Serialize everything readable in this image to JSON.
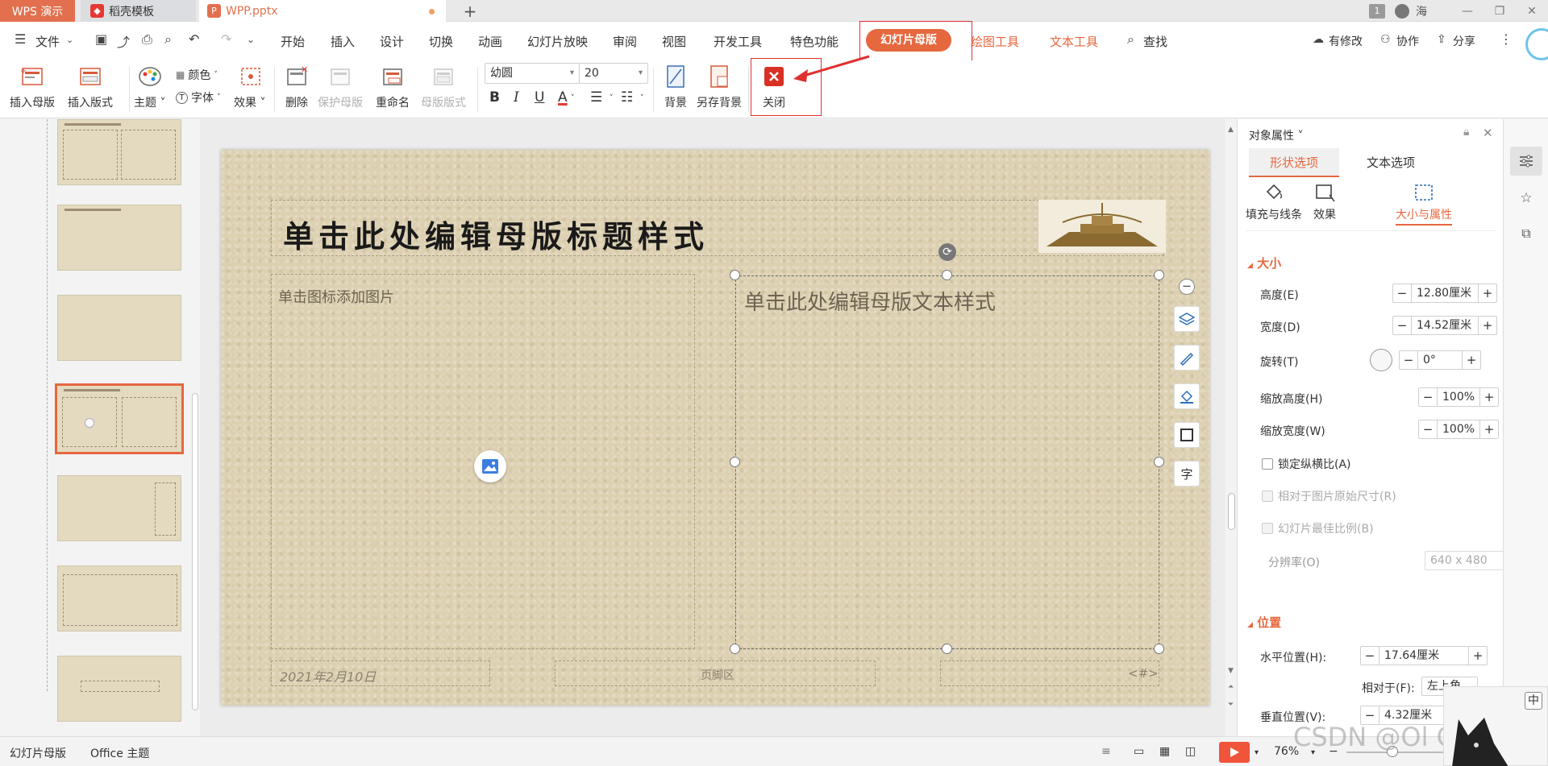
{
  "tabs": {
    "wps": "WPS 演示",
    "daoke": "稻壳模板",
    "wpp": "WPP.pptx",
    "add": "+"
  },
  "window": {
    "badge": "1",
    "user": "海",
    "minimize": "—",
    "restore": "❐",
    "close": "✕"
  },
  "menu": {
    "file": "文件",
    "items": [
      "开始",
      "插入",
      "设计",
      "切换",
      "动画",
      "幻灯片放映",
      "审阅",
      "视图",
      "开发工具",
      "特色功能"
    ],
    "slide_master": "幻灯片母版",
    "draw_tools": "绘图工具",
    "text_tools": "文本工具",
    "search": "查找",
    "has_changes": "有修改",
    "collab": "协作",
    "share": "分享"
  },
  "ribbon": {
    "insert_master": "插入母版",
    "insert_layout": "插入版式",
    "theme": "主题",
    "colors": "颜色",
    "fonts": "字体",
    "effects": "效果",
    "delete": "删除",
    "protect_master": "保护母版",
    "rename": "重命名",
    "master_layout": "母版版式",
    "font_name": "幼圆",
    "font_size": "20",
    "bold": "B",
    "italic": "I",
    "underline": "U",
    "font_color": "A",
    "background": "背景",
    "save_background": "另存背景",
    "close": "关闭"
  },
  "slide": {
    "title": "单击此处编辑母版标题样式",
    "left_placeholder": "单击图标添加图片",
    "right_placeholder": "单击此处编辑母版文本样式",
    "date": "2021年2月10日",
    "footer": "页脚区",
    "page_num": "<#>"
  },
  "panel": {
    "title": "对象属性",
    "tab_shape": "形状选项",
    "tab_text": "文本选项",
    "sub_fill": "填充与线条",
    "sub_effect": "效果",
    "sub_size": "大小与属性",
    "section_size": "大小",
    "height_label": "高度(E)",
    "height_value": "12.80厘米",
    "width_label": "宽度(D)",
    "width_value": "14.52厘米",
    "rotate_label": "旋转(T)",
    "rotate_value": "0°",
    "scale_h_label": "缩放高度(H)",
    "scale_h_value": "100%",
    "scale_w_label": "缩放宽度(W)",
    "scale_w_value": "100%",
    "lock_ratio": "锁定纵横比(A)",
    "relative_original": "相对于图片原始尺寸(R)",
    "best_scale": "幻灯片最佳比例(B)",
    "resolution_label": "分辨率(O)",
    "resolution_value": "640 x 480",
    "section_position": "位置",
    "hpos_label": "水平位置(H):",
    "hpos_value": "17.64厘米",
    "relative_to": "相对于(F):",
    "relative_value": "左上角",
    "vpos_label": "垂直位置(V):",
    "vpos_value": "4.32厘米"
  },
  "status": {
    "mode": "幻灯片母版",
    "theme": "Office 主题",
    "zoom": "76%"
  },
  "watermark": "CSDN @Ol Correct",
  "colors": {
    "accent": "#e5683f",
    "close_red": "#d93025",
    "annotation_red": "#e03030"
  }
}
